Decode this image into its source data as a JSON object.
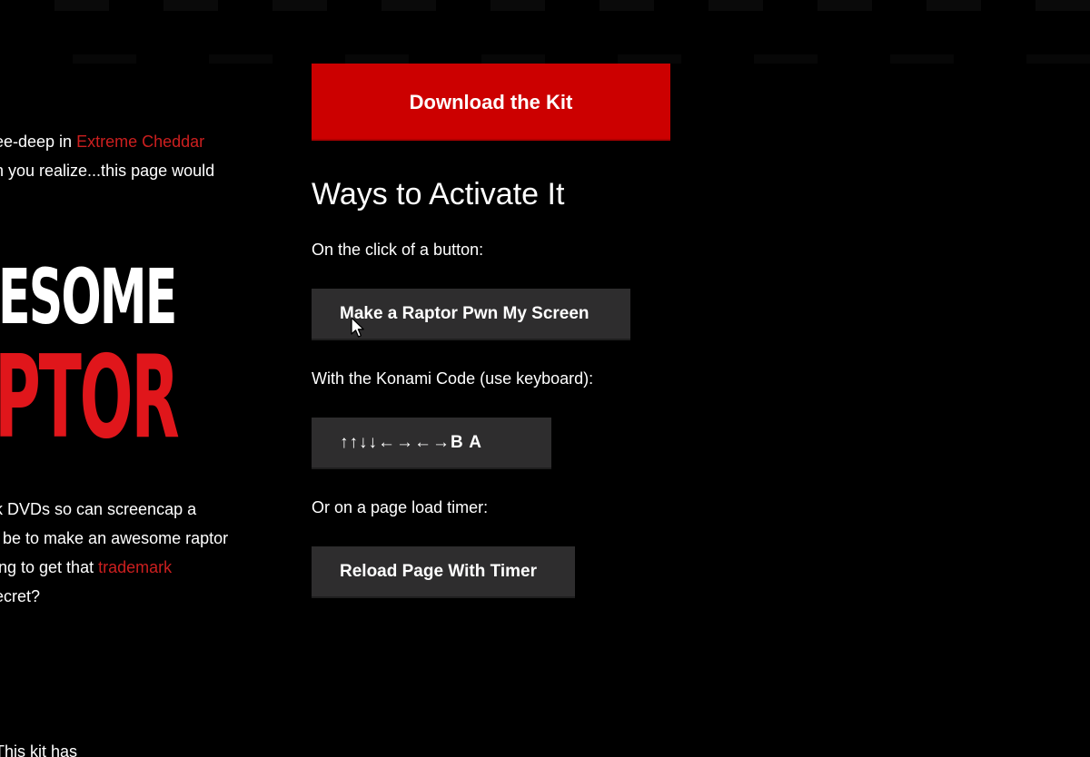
{
  "left_column": {
    "paragraph_1": {
      "line_1_prefix": "ee-deep in ",
      "line_1_link": "Extreme Cheddar",
      "line_2": "n you realize...this page would"
    },
    "logo": {
      "line_1": "ESOME",
      "line_2": "PTOR"
    },
    "paragraph_2": {
      "line_1": "k DVDs so can screencap a",
      "line_2": "l be to make an awesome raptor",
      "line_3_prefix": "ing to get that ",
      "line_3_link": "trademark",
      "line_4": "ecret?"
    },
    "paragraph_3": {
      "line_1": "This kit has"
    }
  },
  "main": {
    "download_button": "Download the Kit",
    "section_title": "Ways to Activate It",
    "click_label": "On the click of a button:",
    "raptor_button": "Make a Raptor Pwn My Screen",
    "konami_label": "With the Konami Code (use keyboard):",
    "konami_button": "↑↑↓↓←→←→B A",
    "timer_label": "Or on a page load timer:",
    "reload_button": "Reload Page With Timer"
  },
  "colors": {
    "background": "#000000",
    "accent_red": "#cc0000",
    "link_red": "#cc1f1f",
    "logo_red": "#e0161b",
    "button_dark": "#2e2d2e",
    "text": "#ffffff"
  },
  "icons": {
    "cursor": "mouse-pointer-icon"
  }
}
